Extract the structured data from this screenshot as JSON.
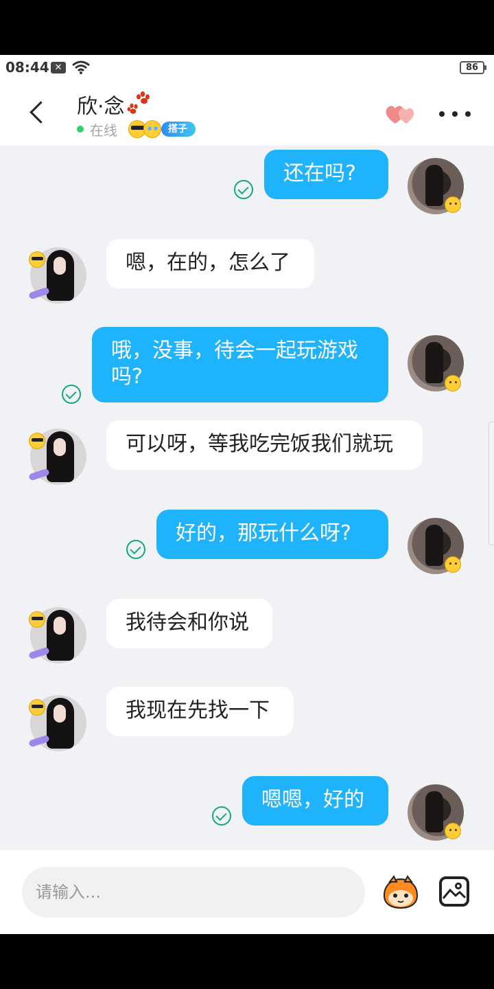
{
  "status_bar": {
    "time": "08:44",
    "battery": "86"
  },
  "header": {
    "title": "欣·念",
    "online_status": "在线",
    "tag": "搭子"
  },
  "messages": [
    {
      "side": "out",
      "text": "还在吗?"
    },
    {
      "side": "in",
      "text": "嗯，在的，怎么了"
    },
    {
      "side": "out",
      "text": "哦，没事，待会一起玩游戏吗?"
    },
    {
      "side": "in",
      "text": "可以呀，等我吃完饭我们就玩"
    },
    {
      "side": "out",
      "text": "好的，那玩什么呀?"
    },
    {
      "side": "in",
      "text": "我待会和你说"
    },
    {
      "side": "in",
      "text": "我现在先找一下"
    },
    {
      "side": "out",
      "text": "嗯嗯，好的"
    }
  ],
  "input": {
    "placeholder": "请输入..."
  },
  "colors": {
    "outgoing_bubble": "#1fb3fb",
    "incoming_bubble": "#ffffff",
    "chat_background": "#f0f2f5",
    "read_check": "#13a87a",
    "online_dot": "#35d06b"
  },
  "icons": {
    "back": "chevron-left-icon",
    "title_decoration": "paw-icon",
    "favorite": "hearts-icon",
    "more": "more-dots-icon",
    "sticker": "mascot-icon",
    "image": "image-icon",
    "read": "check-circle-icon"
  }
}
